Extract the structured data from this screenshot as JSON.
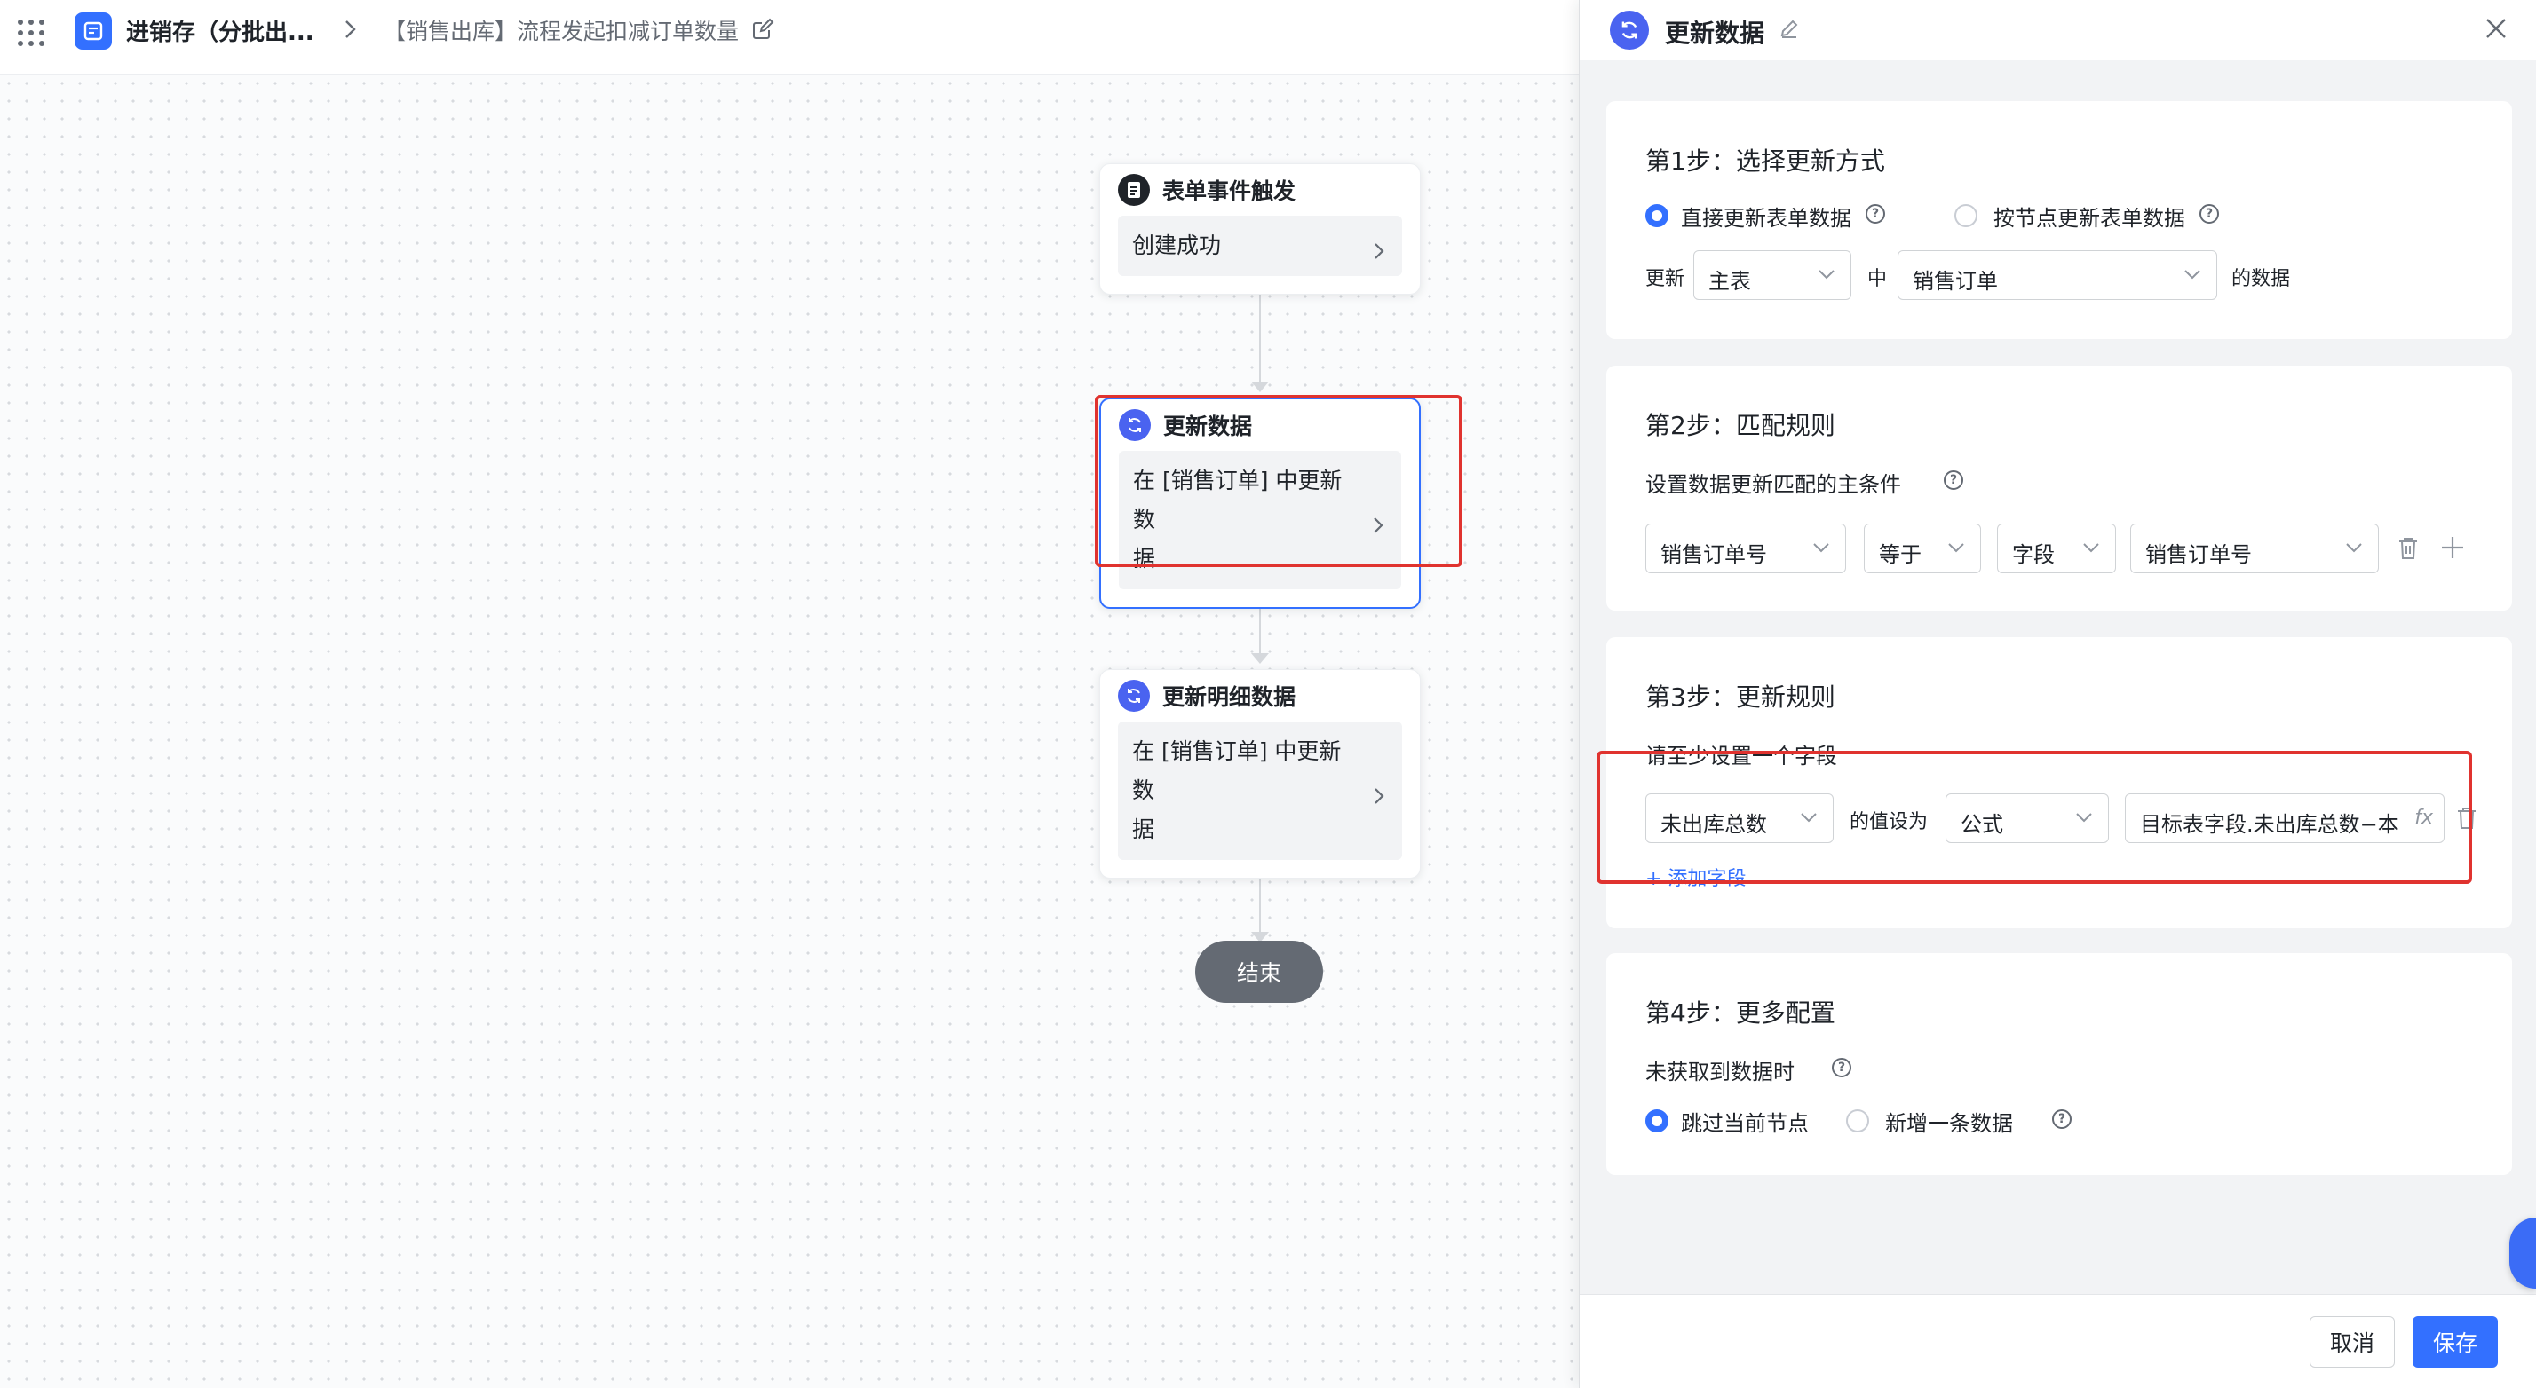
{
  "header": {
    "app_name": "进销存（分批出...",
    "flow_name": "【销售出库】流程发起扣减订单数量"
  },
  "flow": {
    "trigger_node": {
      "title": "表单事件触发",
      "body": "创建成功"
    },
    "update_node": {
      "title": "更新数据",
      "body_line1": "在 [销售订单] 中更新数",
      "body_line2": "据"
    },
    "update_detail_node": {
      "title": "更新明细数据",
      "body_line1": "在 [销售订单] 中更新数",
      "body_line2": "据"
    },
    "end_node": {
      "label": "结束"
    }
  },
  "drawer": {
    "title": "更新数据",
    "step1": {
      "title": "第1步：选择更新方式",
      "option_direct": "直接更新表单数据",
      "option_by_node": "按节点更新表单数据",
      "update_prefix": "更新",
      "table_select": "主表",
      "middle": "中",
      "form_select": "销售订单",
      "suffix": "的数据"
    },
    "step2": {
      "title": "第2步：匹配规则",
      "desc": "设置数据更新匹配的主条件",
      "field_select": "销售订单号",
      "operator_select": "等于",
      "type_select": "字段",
      "value_select": "销售订单号"
    },
    "step3": {
      "title": "第3步：更新规则",
      "hint": "请至少设置一个字段",
      "field_select": "未出库总数",
      "set_label": "的值设为",
      "mode_select": "公式",
      "formula": "目标表字段.未出库总数−本",
      "fx_label": "fx",
      "add_field": "+ 添加字段"
    },
    "step4": {
      "title": "第4步：更多配置",
      "desc": "未获取到数据时",
      "option_skip": "跳过当前节点",
      "option_add": "新增一条数据"
    },
    "footer": {
      "cancel": "取消",
      "save": "保存"
    }
  },
  "colors": {
    "primary": "#3370ff",
    "highlight": "#e0332f",
    "end_node": "#646a73"
  }
}
